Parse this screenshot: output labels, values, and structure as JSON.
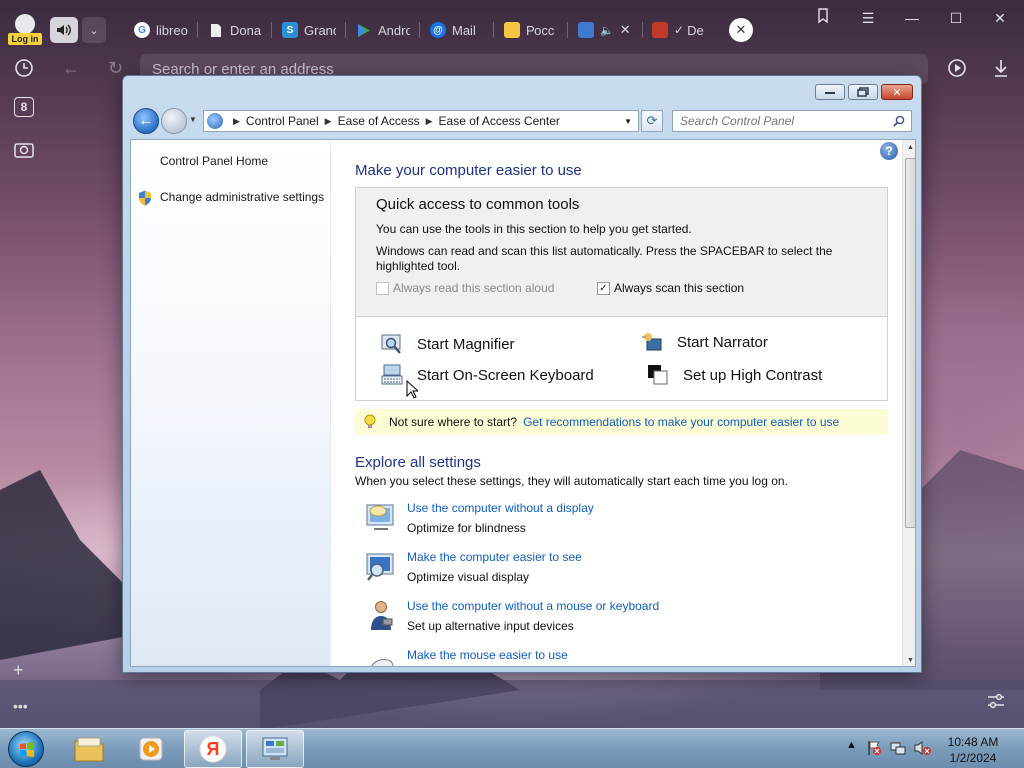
{
  "browser": {
    "login_label": "Log in",
    "tabs": [
      {
        "label": "libreo",
        "fav_color": "#ffffff",
        "fav_glyph": "G"
      },
      {
        "label": "Dona",
        "fav_color": "#ffffff",
        "fav_glyph": ""
      },
      {
        "label": "Grand",
        "fav_color": "#2a8fd8",
        "fav_glyph": ""
      },
      {
        "label": "Andro",
        "fav_color": "#34a853",
        "fav_glyph": ""
      },
      {
        "label": "Mail",
        "fav_color": "#1a73e8",
        "fav_glyph": "@"
      },
      {
        "label": "Росс",
        "fav_color": "#3d7bd1",
        "fav_glyph": ""
      },
      {
        "label": "De",
        "fav_color": "#c0392b",
        "fav_glyph": ""
      }
    ],
    "address_placeholder": "Search or enter an address",
    "tab_count_badge": "8"
  },
  "window": {
    "breadcrumb": [
      "Control Panel",
      "Ease of Access",
      "Ease of Access Center"
    ],
    "search_placeholder": "Search Control Panel"
  },
  "left_pane": {
    "home_link": "Control Panel Home",
    "admin_link": "Change administrative settings"
  },
  "main": {
    "heading": "Make your computer easier to use",
    "quick_access": {
      "title": "Quick access to common tools",
      "line1": "You can use the tools in this section to help you get started.",
      "line2": "Windows can read and scan this list automatically.  Press the SPACEBAR to select the highlighted tool.",
      "read_aloud_label": "Always read this section aloud",
      "read_aloud_checked": false,
      "scan_label": "Always scan this section",
      "scan_checked": true
    },
    "tools": {
      "magnifier": "Start Magnifier",
      "narrator": "Start Narrator",
      "osk": "Start On-Screen Keyboard",
      "contrast": "Set up High Contrast"
    },
    "tip": {
      "text": "Not sure where to start?",
      "link": "Get recommendations to make your computer easier to use"
    },
    "explore": {
      "heading": "Explore all settings",
      "desc": "When you select these settings, they will automatically start each time you log on.",
      "items": [
        {
          "link": "Use the computer without a display",
          "desc": "Optimize for blindness"
        },
        {
          "link": "Make the computer easier to see",
          "desc": "Optimize visual display"
        },
        {
          "link": "Use the computer without a mouse or keyboard",
          "desc": "Set up alternative input devices"
        },
        {
          "link": "Make the mouse easier to use",
          "desc": ""
        }
      ]
    }
  },
  "taskbar": {
    "time": "10:48 AM",
    "date": "1/2/2024"
  }
}
